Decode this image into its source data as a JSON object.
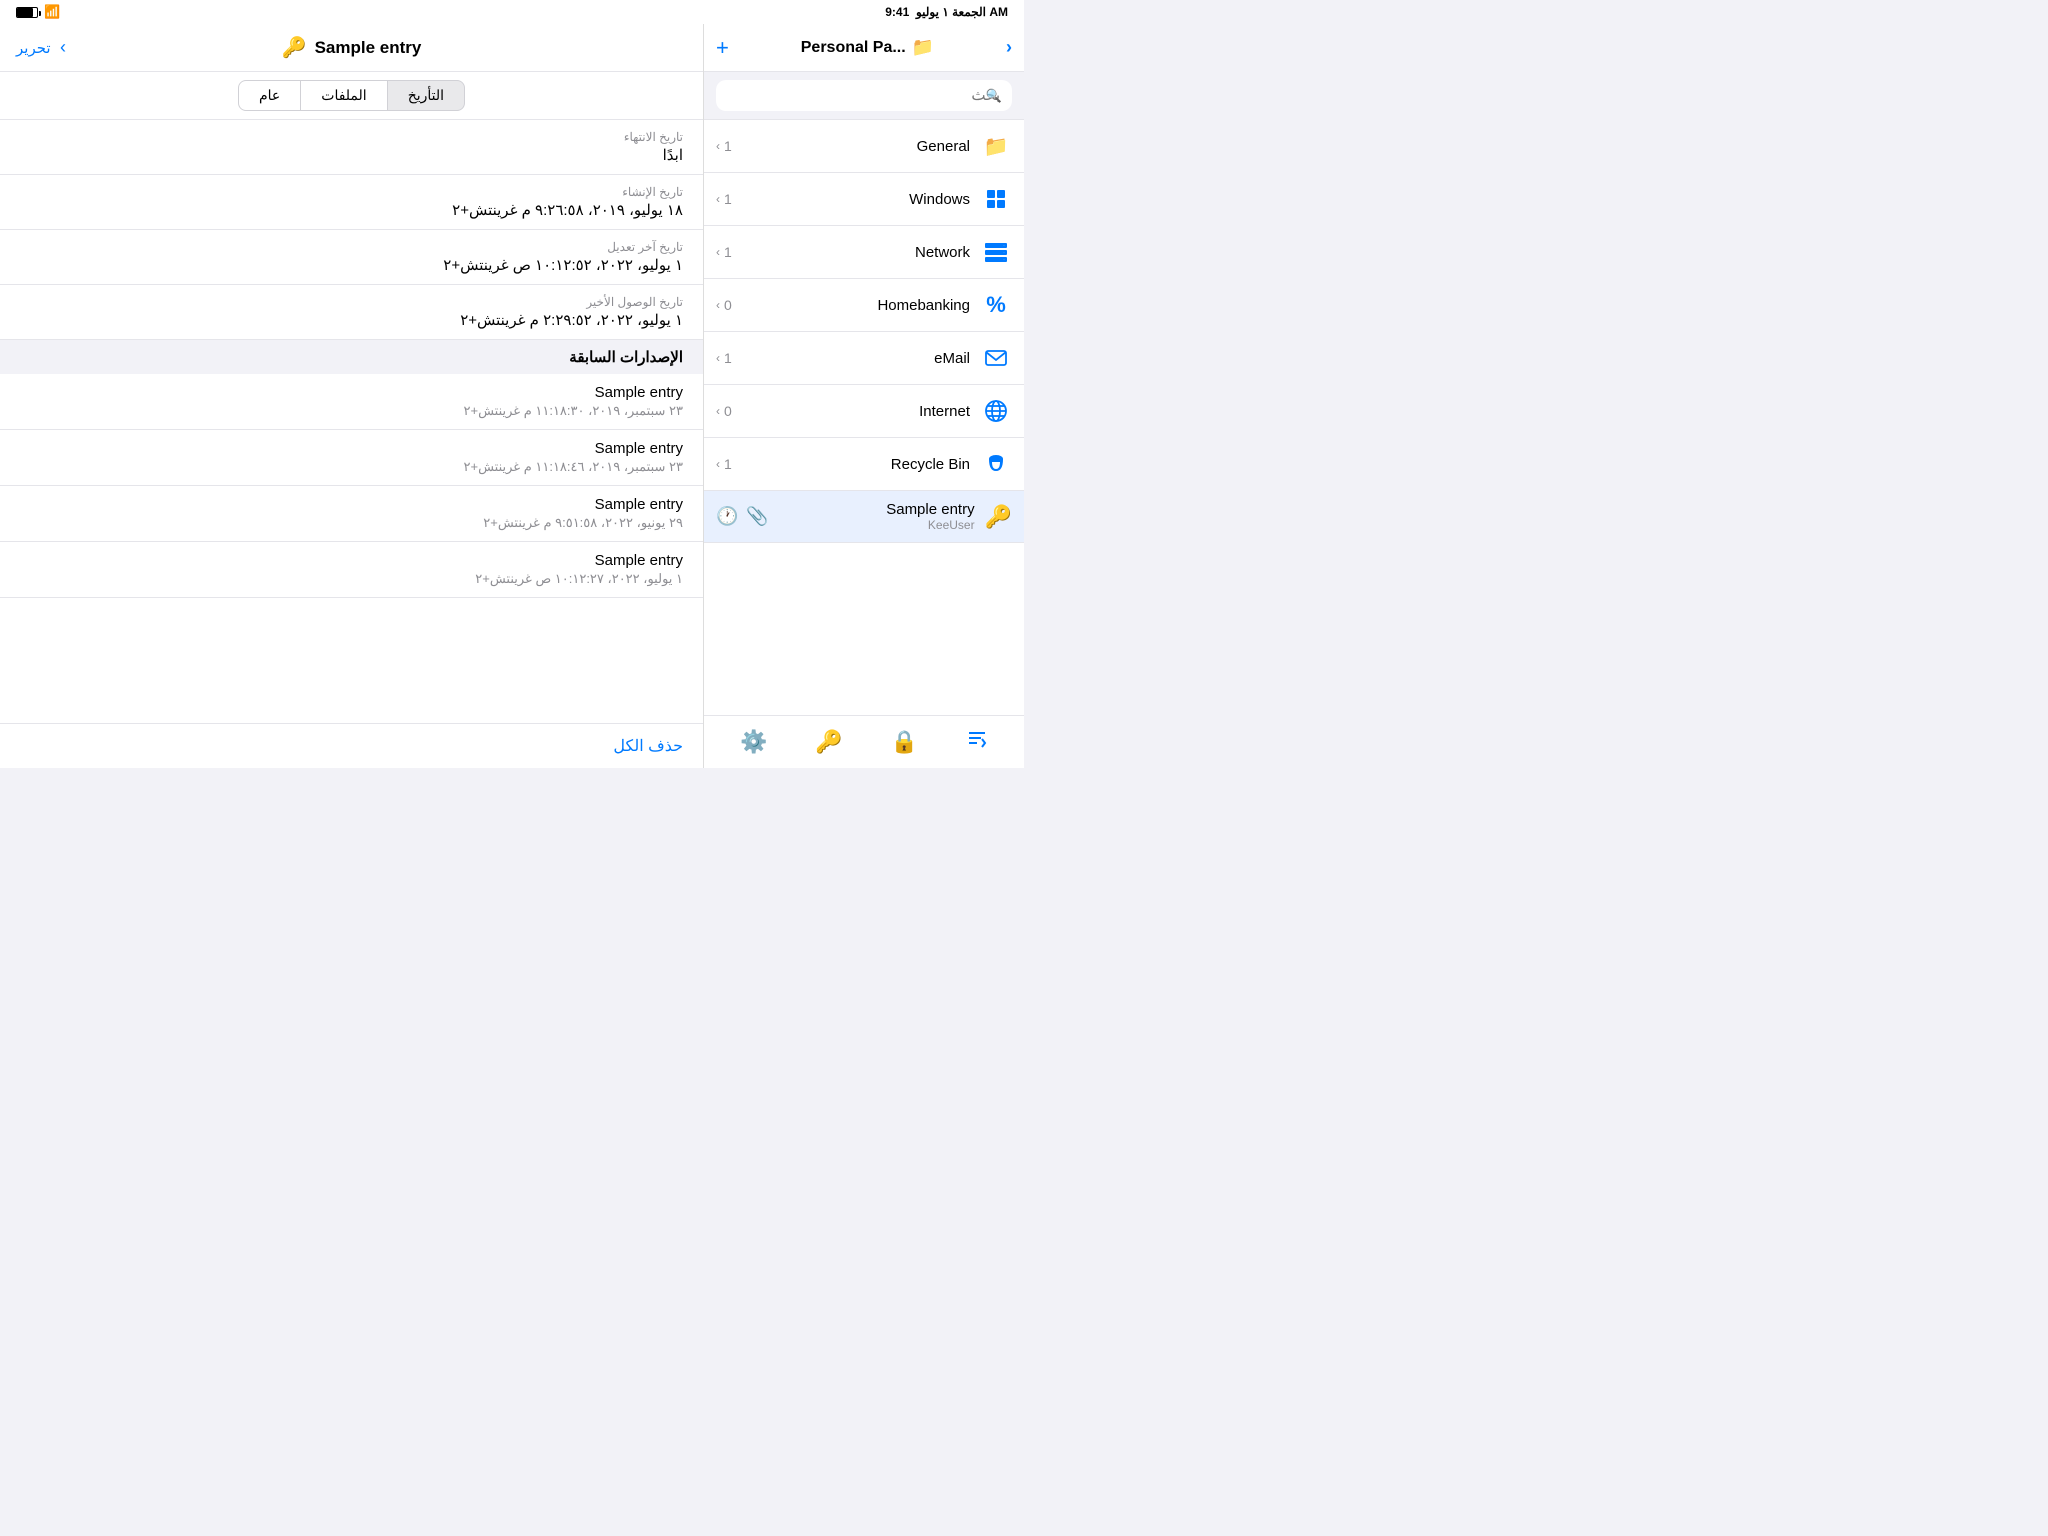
{
  "statusBar": {
    "time": "9:41 AM",
    "dateAr": "الجمعة ١ يوليو",
    "battery": "80",
    "wifi": "wifi"
  },
  "leftPanel": {
    "editLabel": "تحرير",
    "title": "Sample entry",
    "keyIcon": "🔑",
    "tabs": [
      {
        "label": "عام",
        "active": false
      },
      {
        "label": "الملفات",
        "active": false
      },
      {
        "label": "التأريخ",
        "active": true
      }
    ],
    "fields": [
      {
        "label": "تاريخ الانتهاء",
        "value": "ابدًا"
      },
      {
        "label": "تاريخ الإنشاء",
        "value": "١٨ يوليو، ٢٠١٩، ٩:٢٦:٥٨ م غرينتش+٢"
      },
      {
        "label": "تاريخ آخر تعديل",
        "value": "١ يوليو، ٢٠٢٢، ١٠:١٢:٥٢ ص غرينتش+٢"
      },
      {
        "label": "تاريخ الوصول الأخير",
        "value": "١ يوليو، ٢٠٢٢، ٢:٢٩:٥٢ م غرينتش+٢"
      }
    ],
    "previousVersionsLabel": "الإصدارات السابقة",
    "versions": [
      {
        "title": "Sample entry",
        "date": "٢٣ سبتمبر، ٢٠١٩، ١١:١٨:٣٠ م غرينتش+٢"
      },
      {
        "title": "Sample entry",
        "date": "٢٣ سبتمبر، ٢٠١٩، ١١:١٨:٤٦ م غرينتش+٢"
      },
      {
        "title": "Sample entry",
        "date": "٢٩ يونيو، ٢٠٢٢، ٩:٥١:٥٨ م غرينتش+٢"
      },
      {
        "title": "Sample entry",
        "date": "١ يوليو، ٢٠٢٢، ١٠:١٢:٢٧ ص غرينتش+٢"
      }
    ],
    "deleteAllLabel": "حذف الكل"
  },
  "rightPanel": {
    "addIcon": "+",
    "folderTitle": "Personal Pa...",
    "folderIcon": "📁",
    "chevronRight": "›",
    "search": {
      "placeholder": "بحث",
      "value": ""
    },
    "folders": [
      {
        "name": "General",
        "count": 1,
        "iconType": "folder"
      },
      {
        "name": "Windows",
        "count": 1,
        "iconType": "windows"
      },
      {
        "name": "Network",
        "count": 1,
        "iconType": "network"
      },
      {
        "name": "Homebanking",
        "count": 0,
        "iconType": "percent"
      },
      {
        "name": "eMail",
        "count": 1,
        "iconType": "email"
      },
      {
        "name": "Internet",
        "count": 0,
        "iconType": "globe"
      },
      {
        "name": "Recycle Bin",
        "count": 1,
        "iconType": "database"
      }
    ],
    "selectedEntry": {
      "title": "Sample entry",
      "user": "KeeUser",
      "iconType": "key",
      "icons": [
        "clock",
        "paperclip"
      ]
    },
    "footer": {
      "settingsIcon": "⚙",
      "keyIcon": "🔑",
      "lockIcon": "🔒",
      "sortIcon": "sort"
    }
  }
}
